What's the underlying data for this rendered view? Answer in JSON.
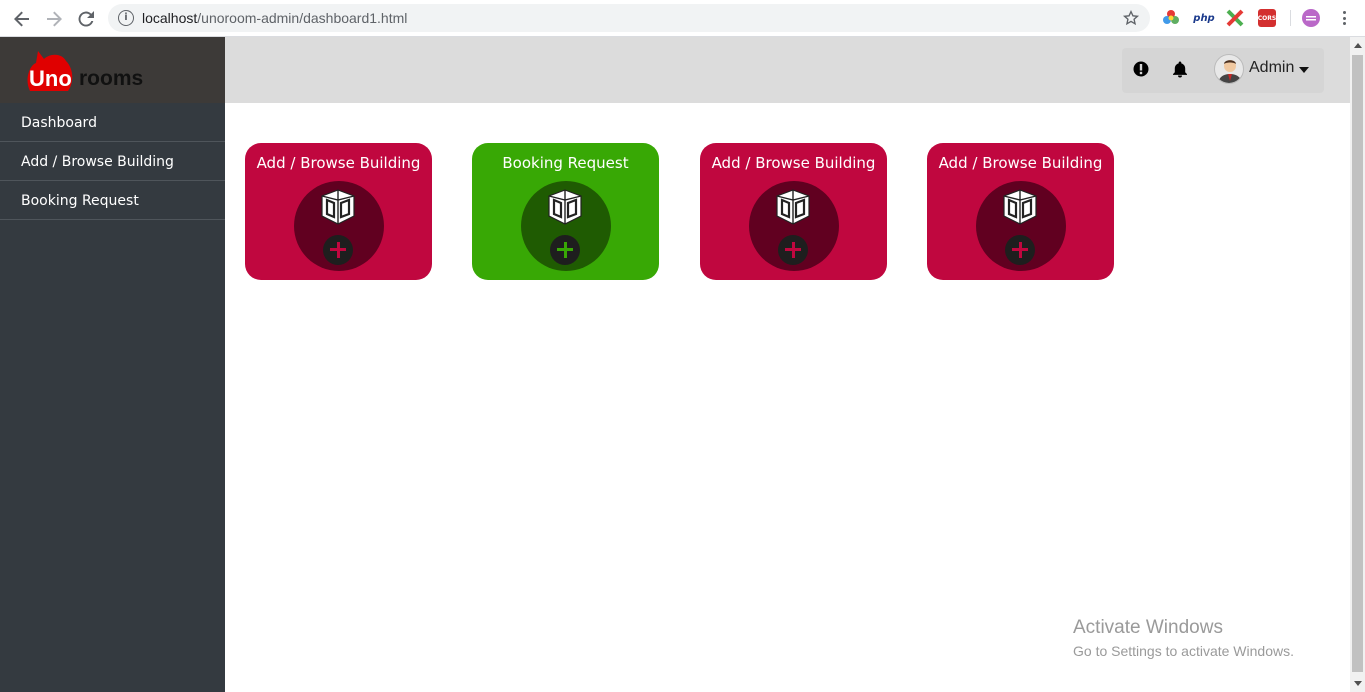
{
  "browser": {
    "url_host": "localhost",
    "url_path": "/unoroom-admin/dashboard1.html",
    "extensions": [
      {
        "name": "color-wheel-extension-icon",
        "color": "#e53935"
      },
      {
        "name": "php-extension-icon",
        "label": "php"
      },
      {
        "name": "x-extension-icon",
        "color": "#4caf50"
      },
      {
        "name": "cors-extension-icon",
        "label": "CORS",
        "color": "#d32f2f"
      },
      {
        "name": "profile-extension-icon",
        "color": "#ba68c8"
      }
    ]
  },
  "brand": {
    "uno": "Uno",
    "rooms": "rooms",
    "color": "#e00000"
  },
  "sidebar": {
    "items": [
      {
        "label": "Dashboard"
      },
      {
        "label": "Add / Browse Building"
      },
      {
        "label": "Booking Request"
      }
    ]
  },
  "topbar": {
    "user_name": "Admin",
    "icons": [
      "alert-icon",
      "bell-icon",
      "avatar"
    ]
  },
  "cards": [
    {
      "title": "Add / Browse Building",
      "bg": "#c0073f",
      "circle": "#610020",
      "plus": "#c0073f"
    },
    {
      "title": "Booking Request",
      "bg": "#38a805",
      "circle": "#1f5b02",
      "plus": "#38a805"
    },
    {
      "title": "Add / Browse Building",
      "bg": "#c0073f",
      "circle": "#610020",
      "plus": "#c0073f"
    },
    {
      "title": "Add / Browse Building",
      "bg": "#c0073f",
      "circle": "#610020",
      "plus": "#c0073f"
    }
  ],
  "watermark": {
    "line1": "Activate Windows",
    "line2": "Go to Settings to activate Windows."
  }
}
